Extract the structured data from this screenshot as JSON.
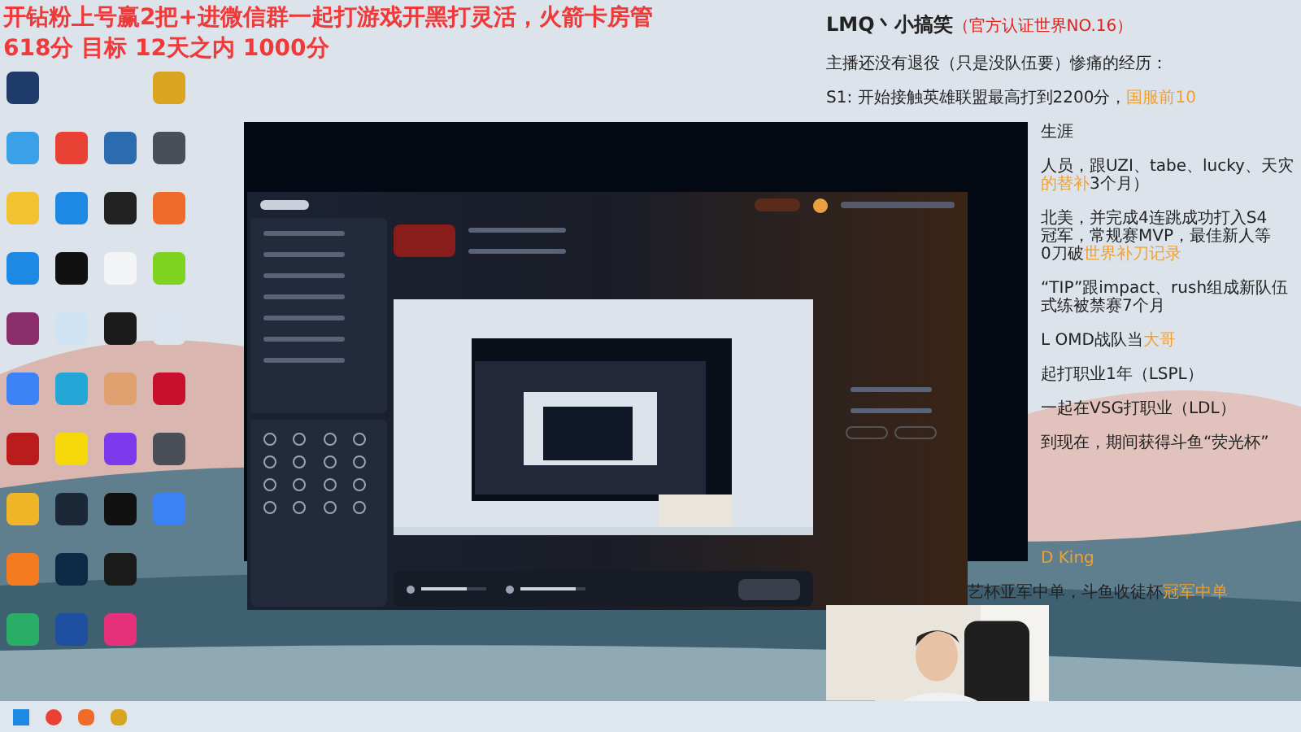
{
  "banner": [
    "开钻粉上号赢2把+进微信群一起打游戏开黑打灵活，火箭卡房管",
    "618分 目标 12天之内 1000分"
  ],
  "notes": {
    "title": "LMQ丶小搞笑",
    "badge": "（官方认证世界NO.16）",
    "top": [
      [
        {
          "kind": "full",
          "parts": [
            {
              "text": "主播还没有退役（只是没队伍要）惨痛的经历：",
              "highlight": false
            }
          ]
        }
      ],
      [
        {
          "kind": "full",
          "parts": [
            {
              "text": "S1:  开始接触英雄联盟最高打到2200分，",
              "highlight": false
            },
            {
              "text": "国服前10",
              "highlight": true
            }
          ]
        }
      ],
      [
        {
          "kind": "cut",
          "parts": [
            {
              "text": "生涯",
              "highlight": false
            }
          ]
        }
      ],
      [
        {
          "kind": "cut",
          "parts": [
            {
              "text": "人员，跟UZI、tabe、lucky、天灾",
              "highlight": false
            }
          ]
        },
        {
          "kind": "cut",
          "parts": [
            {
              "text": "的替补",
              "highlight": true
            },
            {
              "text": "3个月）",
              "highlight": false
            }
          ]
        }
      ],
      [
        {
          "kind": "cut",
          "parts": [
            {
              "text": "北美，并完成4连跳成功打入S4",
              "highlight": false
            }
          ]
        },
        {
          "kind": "cut",
          "parts": [
            {
              "text": "冠军，常规赛MVP，最佳新人等",
              "highlight": false
            }
          ]
        },
        {
          "kind": "cut",
          "parts": [
            {
              "text": "0刀破",
              "highlight": false
            },
            {
              "text": "世界补刀记录",
              "highlight": true
            }
          ]
        }
      ],
      [
        {
          "kind": "cut",
          "parts": [
            {
              "text": "“TIP”跟impact、rush组成新队伍",
              "highlight": false
            }
          ]
        },
        {
          "kind": "cut",
          "parts": [
            {
              "text": "式练被禁赛7个月",
              "highlight": false
            }
          ]
        }
      ],
      [
        {
          "kind": "cut",
          "parts": [
            {
              "text": "L OMD战队当",
              "highlight": false
            },
            {
              "text": "大哥",
              "highlight": true
            }
          ]
        }
      ],
      [
        {
          "kind": "cut",
          "parts": [
            {
              "text": "起打职业1年（LSPL）",
              "highlight": false
            }
          ]
        }
      ],
      [
        {
          "kind": "cut",
          "parts": [
            {
              "text": "一起在VSG打职业（LDL）",
              "highlight": false
            }
          ]
        }
      ],
      [
        {
          "kind": "cut",
          "parts": [
            {
              "text": "到现在，期间获得斗鱼“荧光杯”",
              "highlight": false
            }
          ]
        }
      ]
    ],
    "bottom": [
      [
        {
          "kind": "cut",
          "parts": [
            {
              "text": "D King",
              "highlight": true
            }
          ]
        }
      ],
      [
        {
          "kind": "edge",
          "parts": [
            {
              "text": "艺杯亚军中单，斗鱼收徒杯",
              "highlight": false
            },
            {
              "text": "冠军中单",
              "highlight": true
            }
          ]
        }
      ]
    ]
  },
  "app": {
    "sliders": [
      {
        "level": 0.7
      },
      {
        "level": 0.85
      }
    ]
  }
}
